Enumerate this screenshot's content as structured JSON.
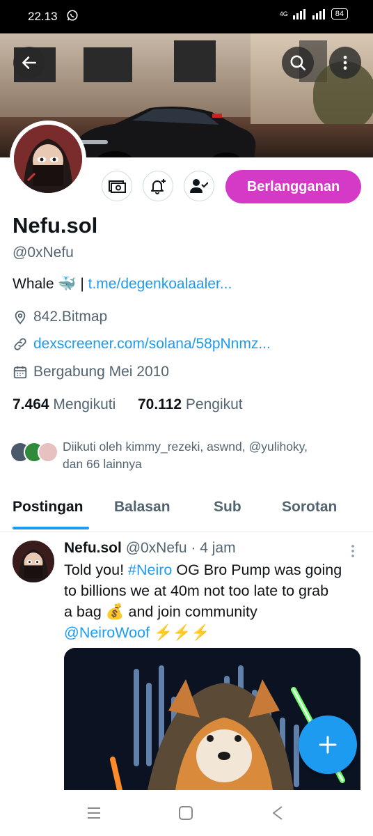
{
  "status_bar": {
    "time": "22.13",
    "network": "4G",
    "battery": "84"
  },
  "profile": {
    "display_name": "Nefu.sol",
    "handle": "@0xNefu",
    "bio_text": "Whale 🐳 | ",
    "bio_link": "t.me/degenkoalaaler...",
    "location": "842.Bitmap",
    "website": "dexscreener.com/solana/58pNnmz...",
    "joined": "Bergabung Mei 2010",
    "following_count": "7.464",
    "following_label": "Mengikuti",
    "followers_count": "70.112",
    "followers_label": "Pengikut",
    "followed_by_line1": "Diikuti oleh kimmy_rezeki, aswnd, @yulihoky,",
    "followed_by_line2": "dan 66 lainnya",
    "subscribe_label": "Berlangganan"
  },
  "tabs": [
    {
      "label": "Postingan",
      "active": true
    },
    {
      "label": "Balasan",
      "active": false
    },
    {
      "label": "Sub",
      "active": false
    },
    {
      "label": "Sorotan",
      "active": false
    }
  ],
  "post": {
    "author": "Nefu.sol",
    "handle_time": "@0xNefu · 4 jam",
    "line1_pre": "Told you! ",
    "line1_tag": "#Neiro",
    "line1_post": " OG Bro Pump was going",
    "line2": "to billions we at 40m not too late to grab",
    "line3": "a bag 💰 and join community",
    "mention": "@NeiroWoof",
    "emoji_tail": " ⚡⚡⚡"
  },
  "colors": {
    "accent": "#1d9bf0",
    "subscribe": "#d43ac6",
    "muted": "#536471"
  },
  "icons": [
    "back-arrow-icon",
    "search-icon",
    "more-vertical-icon",
    "money-icon",
    "bell-plus-icon",
    "person-check-icon",
    "location-pin-icon",
    "link-icon",
    "calendar-icon",
    "plus-icon"
  ]
}
